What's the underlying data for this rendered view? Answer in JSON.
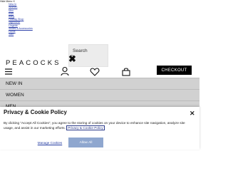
{
  "skip_menu": {
    "title": "Hide Menu X",
    "items": [
      "New In",
      "Women",
      "Men",
      "Kids",
      "Baby",
      "Holiday Shop",
      "Nightwear",
      "Lingerie",
      "Shoes & Accessories",
      "Home",
      "Sale"
    ]
  },
  "header": {
    "logo_text": "PEACOCKS",
    "search_label": "Search",
    "close_glyph": "✖",
    "checkout_label": "CHECKOUT"
  },
  "nav": {
    "items": [
      "NEW IN",
      "WOMEN",
      "MEN"
    ]
  },
  "cookie_banner": {
    "title": "Privacy & Cookie Policy",
    "close_glyph": "✕",
    "body_before": "By clicking “Accept All Cookies”, you agree to the storing of cookies on your device to enhance site navigation, analyze site usage, and assist in our marketing efforts.",
    "policy_link_text": "Privacy & Cookie Policy",
    "manage_label": "Manage Cookies",
    "allow_label": "Allow All"
  },
  "colors": {
    "checkout_bg": "#000000",
    "allow_bg": "#8fa7cf",
    "link": "#2b3a8a"
  }
}
